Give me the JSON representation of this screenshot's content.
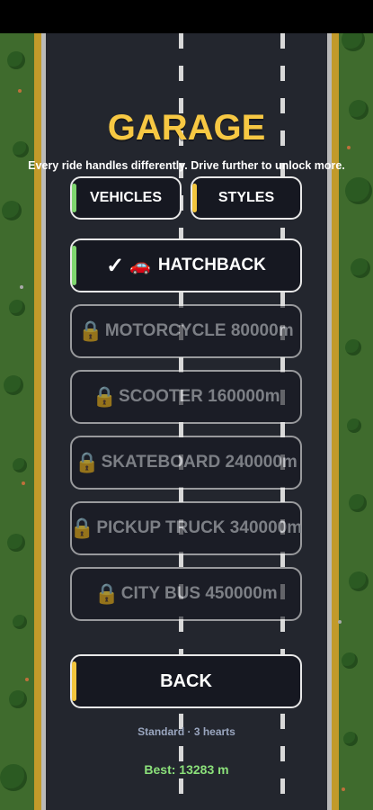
{
  "title": "GARAGE",
  "subtitle": "Every ride handles differently. Drive further to unlock more.",
  "tabs": [
    {
      "label": "VEHICLES",
      "accent": "#7fd66f"
    },
    {
      "label": "STYLES",
      "accent": "#f2c53d"
    }
  ],
  "vehicles": [
    {
      "label": "HATCHBACK",
      "prefix": "✓",
      "icon": "car-emoji",
      "locked": false,
      "accent": "#7fd66f"
    },
    {
      "label": "MOTORCYCLE  80000m",
      "icon": "lock-icon",
      "locked": true
    },
    {
      "label": "SCOOTER  160000m",
      "icon": "lock-icon",
      "locked": true
    },
    {
      "label": "SKATEBOARD  240000m",
      "icon": "lock-icon",
      "locked": true
    },
    {
      "label": "PICKUP TRUCK  340000m",
      "icon": "lock-icon",
      "locked": true
    },
    {
      "label": "CITY BUS  450000m",
      "icon": "lock-icon",
      "locked": true
    }
  ],
  "back": {
    "label": "BACK",
    "accent": "#f2c53d"
  },
  "mode_text": "Standard · 3 hearts",
  "best_text": "Best: 13283 m",
  "colors": {
    "title": "#f7c843",
    "road": "#23262e",
    "grass": "#3f6b2d",
    "best": "#8be07a"
  }
}
